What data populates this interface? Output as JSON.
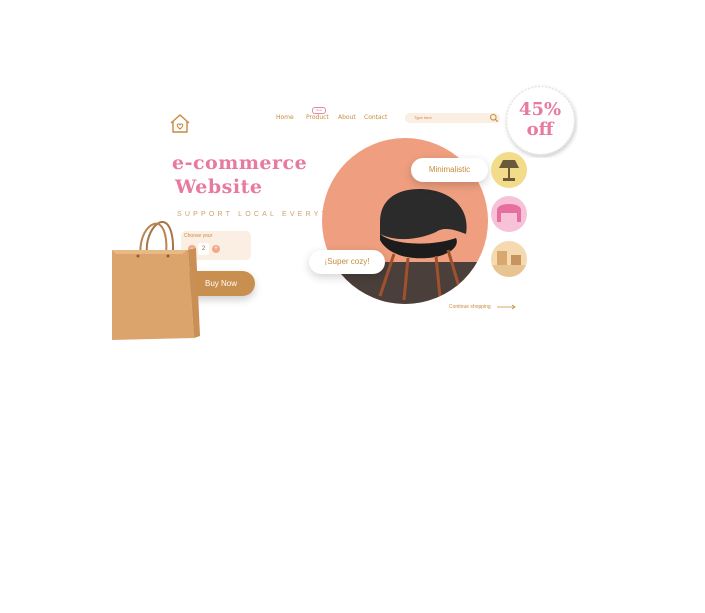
{
  "header": {
    "logo_icon": "house-heart-icon",
    "nav": {
      "home": "Home",
      "product": "Product",
      "about": "About",
      "contact": "Contact"
    },
    "product_badge": "New",
    "search": {
      "placeholder": "Type here",
      "icon": "search-icon"
    }
  },
  "hero": {
    "title_line1": "e-commerce",
    "title_line2": "Website",
    "tagline": "SUPPORT LOCAL EVERYTHING",
    "quantity": {
      "label": "Choose your",
      "value": "2",
      "minus": "−",
      "plus": "+"
    },
    "buy_button": "Buy Now",
    "tags": {
      "minimalistic": "Minimalistic",
      "cozy": "¡Super cozy!"
    },
    "continue_link": "Continue shopping",
    "discount": {
      "percent": "45%",
      "off": "off"
    }
  },
  "colors": {
    "pink": "#e8799f",
    "brown": "#c98f4e",
    "peach": "#ef9f7f",
    "cream": "#fbeee2"
  }
}
